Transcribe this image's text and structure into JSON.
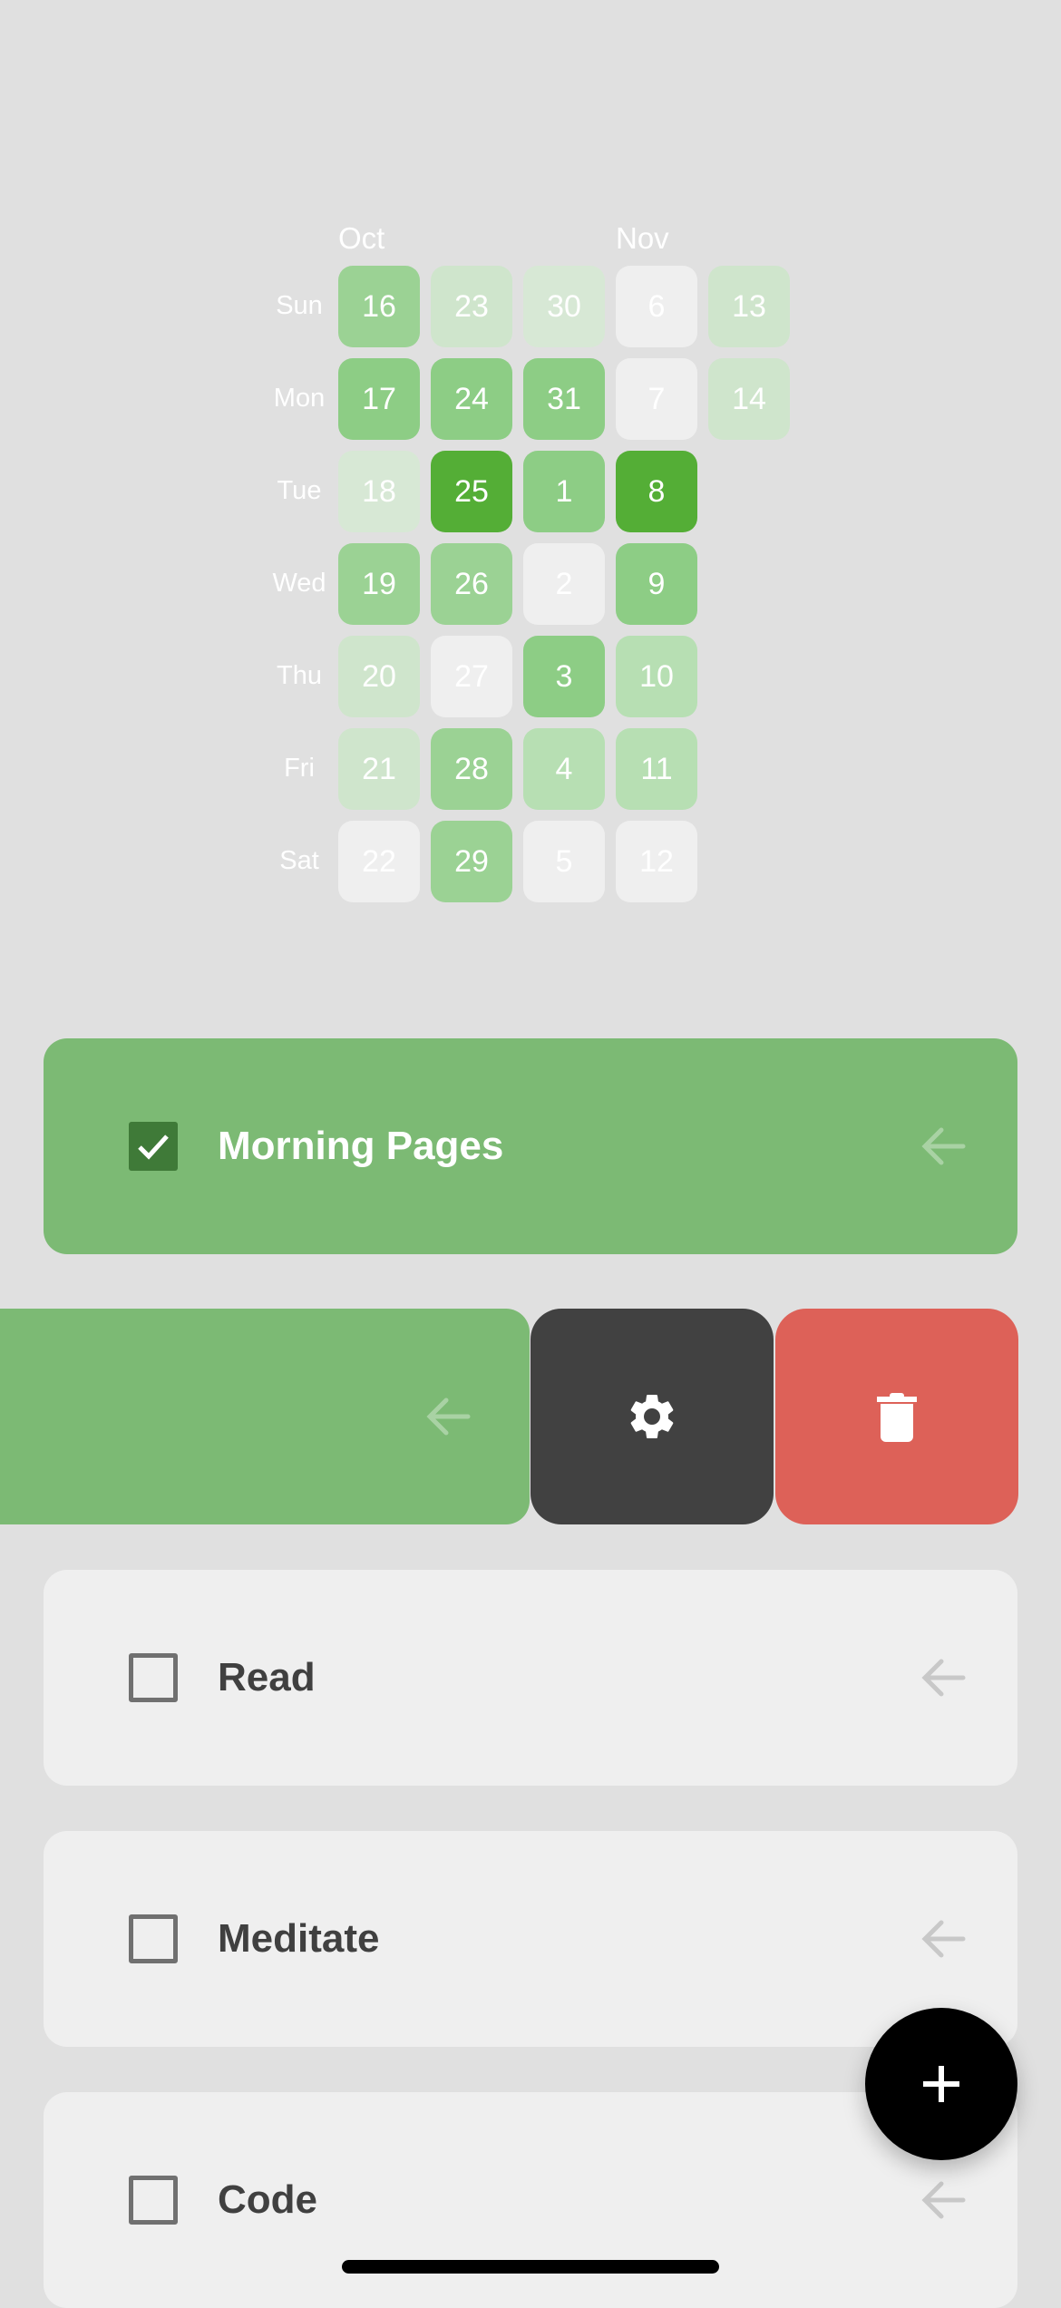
{
  "heatmap": {
    "months": [
      {
        "label": "Oct",
        "column": 0
      },
      {
        "label": "Nov",
        "column": 3
      }
    ],
    "weekdays": [
      "Sun",
      "Mon",
      "Tue",
      "Wed",
      "Thu",
      "Fri",
      "Sat"
    ],
    "levels": {
      "0": "#efefef",
      "1": "#d7e8d5",
      "2": "#cfe5cc",
      "3": "#b7dfb3",
      "4": "#9bd294",
      "5": "#8dcd85",
      "6": "#54ae36"
    },
    "columns": [
      [
        {
          "day": "16",
          "level": 4
        },
        {
          "day": "17",
          "level": 5
        },
        {
          "day": "18",
          "level": 1
        },
        {
          "day": "19",
          "level": 4
        },
        {
          "day": "20",
          "level": 2
        },
        {
          "day": "21",
          "level": 2
        },
        {
          "day": "22",
          "level": 0
        }
      ],
      [
        {
          "day": "23",
          "level": 2
        },
        {
          "day": "24",
          "level": 5
        },
        {
          "day": "25",
          "level": 6
        },
        {
          "day": "26",
          "level": 4
        },
        {
          "day": "27",
          "level": 0
        },
        {
          "day": "28",
          "level": 4
        },
        {
          "day": "29",
          "level": 4
        }
      ],
      [
        {
          "day": "30",
          "level": 1
        },
        {
          "day": "31",
          "level": 5
        },
        {
          "day": "1",
          "level": 5
        },
        {
          "day": "2",
          "level": 0
        },
        {
          "day": "3",
          "level": 5
        },
        {
          "day": "4",
          "level": 3
        },
        {
          "day": "5",
          "level": 0
        }
      ],
      [
        {
          "day": "6",
          "level": 0
        },
        {
          "day": "7",
          "level": 0
        },
        {
          "day": "8",
          "level": 6
        },
        {
          "day": "9",
          "level": 5
        },
        {
          "day": "10",
          "level": 3
        },
        {
          "day": "11",
          "level": 3
        },
        {
          "day": "12",
          "level": 0
        }
      ],
      [
        {
          "day": "13",
          "level": 2
        },
        {
          "day": "14",
          "level": 2
        }
      ]
    ]
  },
  "habits": [
    {
      "name": "Morning Pages",
      "completed": true
    },
    {
      "name": "",
      "completed": true,
      "swiped_open": true
    },
    {
      "name": "Read",
      "completed": false
    },
    {
      "name": "Meditate",
      "completed": false
    },
    {
      "name": "Code",
      "completed": false
    }
  ],
  "swipe_actions": {
    "settings_icon": "gear-icon",
    "delete_icon": "trash-icon",
    "settings_color": "#414141",
    "delete_color": "#dd6158"
  },
  "colors": {
    "done_card": "#7cba74",
    "todo_card": "#efefef",
    "checkbox_checked": "#3f7a38",
    "background": "#e0e0e0"
  },
  "fab": {
    "icon": "plus-icon"
  }
}
